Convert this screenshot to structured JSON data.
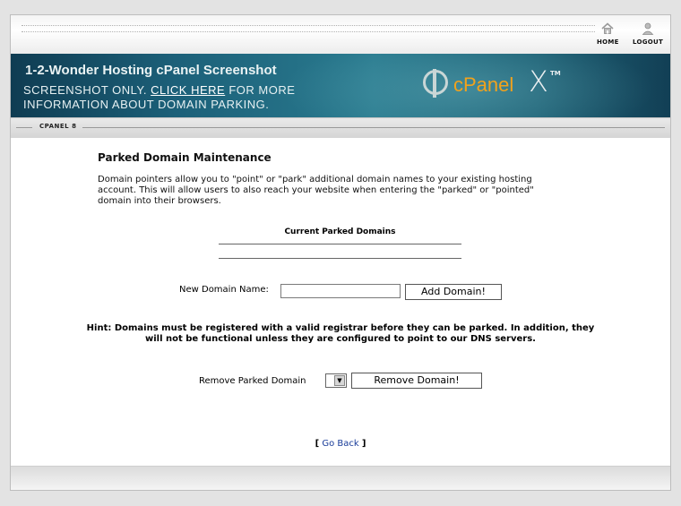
{
  "nav": {
    "home_label": "HOME",
    "logout_label": "LOGOUT",
    "home_icon": "home-icon",
    "logout_icon": "user-icon"
  },
  "banner": {
    "title": "1-2-Wonder Hosting cPanel Screenshot",
    "line1_before": "SCREENSHOT ONLY.",
    "line1_link": "CLICK HERE",
    "line1_after": "FOR MORE",
    "line2": "INFORMATION ABOUT DOMAIN PARKING.",
    "logo_text": "cPanel",
    "logo_x": "X",
    "logo_tm": "TM"
  },
  "subbar": {
    "label": "CPANEL 8"
  },
  "main": {
    "title": "Parked Domain Maintenance",
    "description": "Domain pointers allow you to \"point\" or \"park\" additional domain names to your existing hosting account. This will allow users to also reach your website when entering the \"parked\" or \"pointed\" domain into their browsers.",
    "current_parked_heading": "Current Parked Domains",
    "new_domain_label": "New Domain Name:",
    "new_domain_value": "",
    "add_button": "Add Domain!",
    "hint": "Hint: Domains must be registered with a valid registrar before they can be parked. In addition, they will not be functional unless they are configured to point to our DNS servers.",
    "remove_label": "Remove Parked Domain",
    "remove_select_value": "",
    "remove_button": "Remove Domain!",
    "go_back_open": "[",
    "go_back": "Go Back",
    "go_back_close": "]"
  },
  "colors": {
    "banner": "#1c6079",
    "logo_accent": "#f2a21c",
    "link": "#1a3d9a"
  }
}
